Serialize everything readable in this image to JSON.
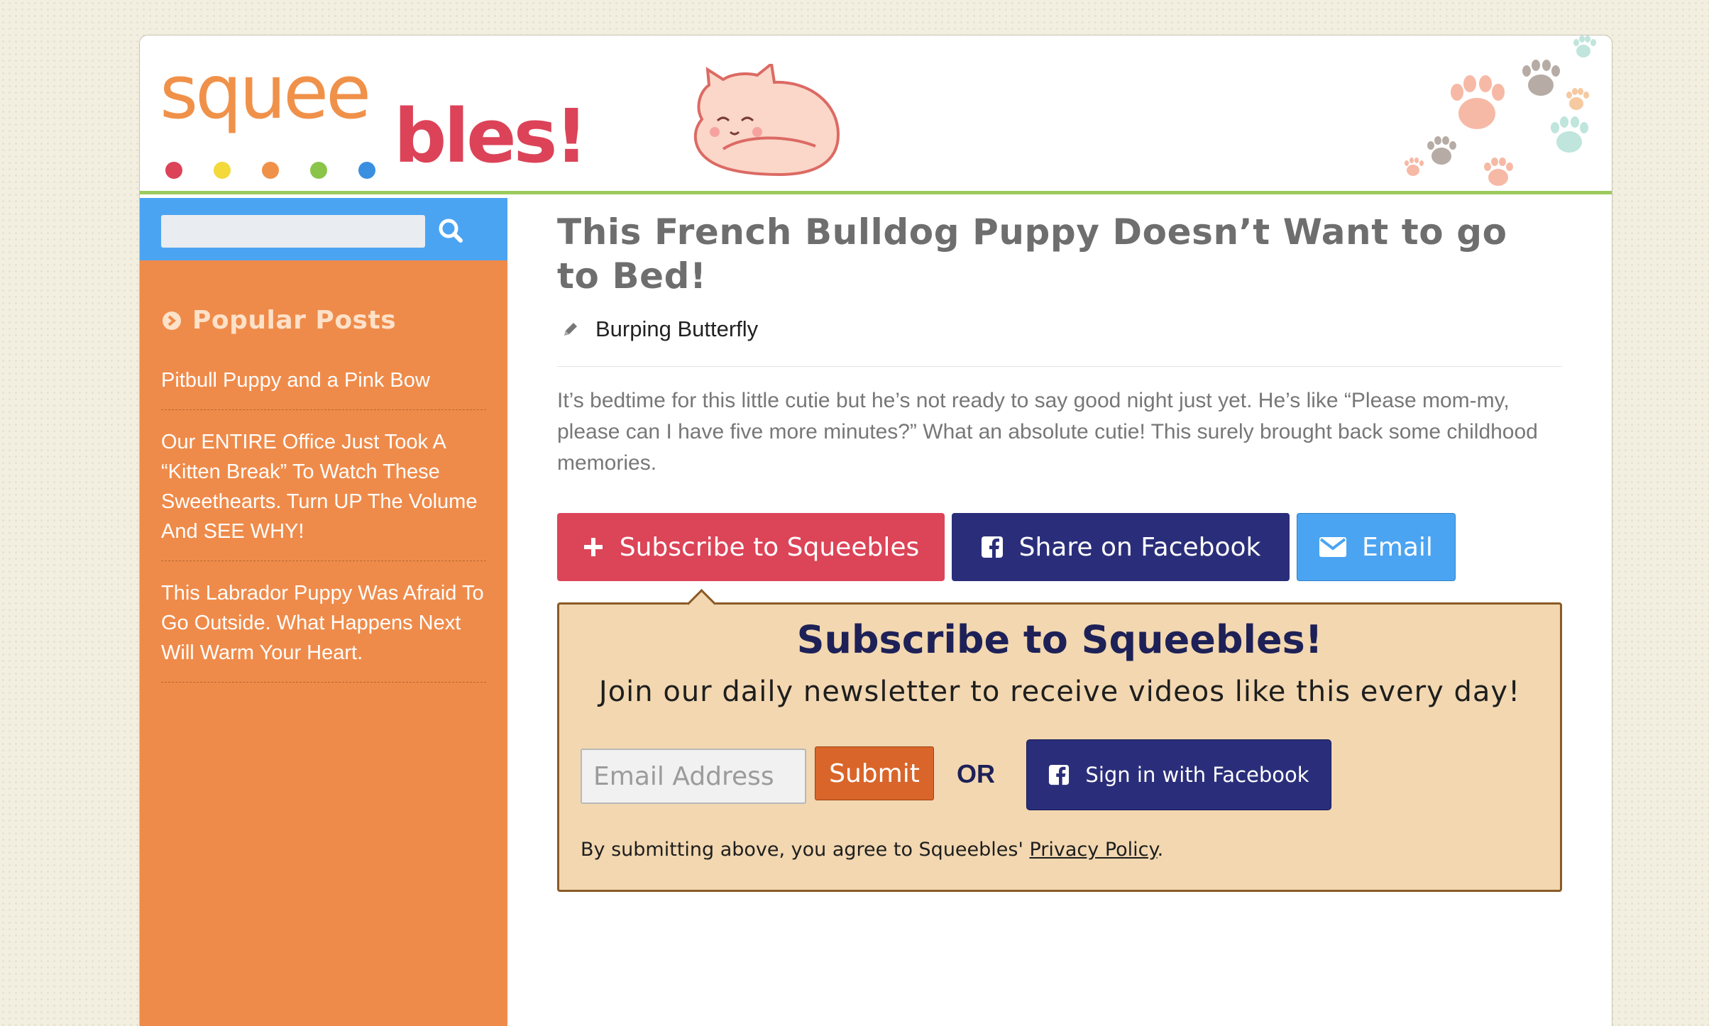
{
  "site": {
    "logo_top": "squee",
    "logo_bottom": "bles!",
    "dot_colors": [
      "#dc4358",
      "#f3d93a",
      "#f0914a",
      "#8ac54a",
      "#3a8fe0"
    ]
  },
  "sidebar": {
    "search": {
      "placeholder": "",
      "icon": "search-icon"
    },
    "popular_title": "Popular Posts",
    "popular_posts": [
      "Pitbull Puppy and a Pink Bow",
      "Our ENTIRE Office Just Took A “Kitten Break” To Watch These Sweethearts. Turn UP The Volume And SEE WHY!",
      "This Labrador Puppy Was Afraid To Go Outside. What Happens Next Will Warm Your Heart."
    ]
  },
  "article": {
    "title": "This French Bulldog Puppy Doesn’t Want to go to Bed!",
    "author": "Burping Butterfly",
    "body": "It’s bedtime for this little cutie but he’s not ready to say good night just yet. He’s like “Please mom-my, please can I have five more minutes?” What an absolute cutie! This surely brought back some childhood memories."
  },
  "share": {
    "subscribe_label": "Subscribe to Squeebles",
    "facebook_label": "Share on Facebook",
    "email_label": "Email"
  },
  "subscribe_box": {
    "title": "Subscribe to Squeebles!",
    "subtitle": "Join our daily newsletter to receive videos like this every day!",
    "email_placeholder": "Email Address",
    "submit_label": "Submit",
    "or_label": "OR",
    "facebook_signin_label": "Sign in with Facebook",
    "legal_prefix": "By submitting above, you agree to Squeebles'",
    "privacy_link": "Privacy Policy",
    "legal_suffix": "."
  },
  "colors": {
    "sidebar": "#ef8b4a",
    "search_bar": "#4ba4f2",
    "header_rule": "#9ccb5d",
    "subscribe_red": "#dc4458",
    "facebook_navy": "#2a2e7a",
    "callout_bg": "#f2d7b0"
  }
}
